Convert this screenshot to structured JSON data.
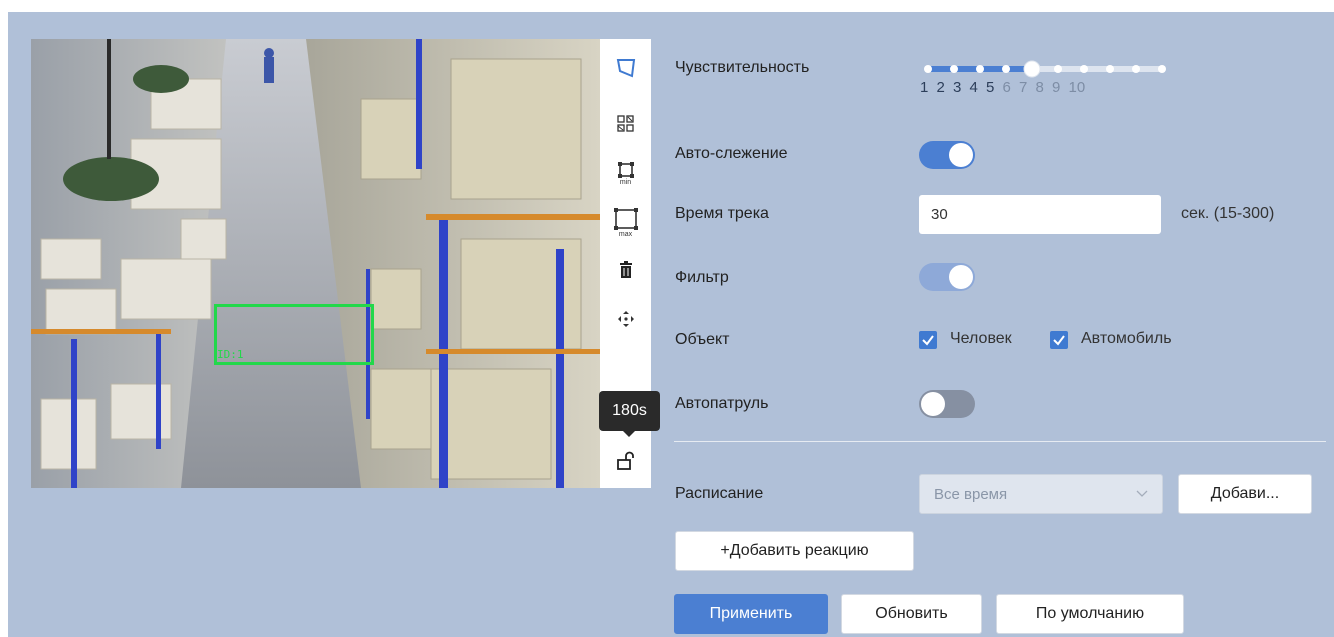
{
  "video": {
    "detection_label": "ID:1"
  },
  "toolbar": {
    "tooltip": "180s",
    "tools": [
      "polygon-icon",
      "grid-icon",
      "min-box-icon",
      "max-box-icon",
      "trash-icon",
      "move-icon",
      "unlock-icon"
    ],
    "min_caption": "min",
    "max_caption": "max"
  },
  "sensitivity": {
    "label": "Чувствительность",
    "levels": [
      "1",
      "2",
      "3",
      "4",
      "5",
      "6",
      "7",
      "8",
      "9",
      "10"
    ],
    "value": 5
  },
  "auto_tracking": {
    "label": "Авто-слежение",
    "on": true
  },
  "track_time": {
    "label": "Время трека",
    "value": "30",
    "unit": "сек. (15-300)"
  },
  "filter": {
    "label": "Фильтр",
    "on": true,
    "disabled": true
  },
  "object": {
    "label": "Объект",
    "options": [
      {
        "label": "Человек",
        "checked": true
      },
      {
        "label": "Автомобиль",
        "checked": true
      }
    ]
  },
  "autopatrol": {
    "label": "Автопатруль",
    "on": false
  },
  "schedule": {
    "label": "Расписание",
    "selected": "Все время",
    "add_button": "Добави..."
  },
  "add_reaction_button": "+Добавить реакцию",
  "actions": {
    "apply": "Применить",
    "refresh": "Обновить",
    "default": "По умолчанию"
  },
  "colors": {
    "accent": "#4b7fd2",
    "panel": "#b0c0d8",
    "detection": "#22d84a"
  }
}
